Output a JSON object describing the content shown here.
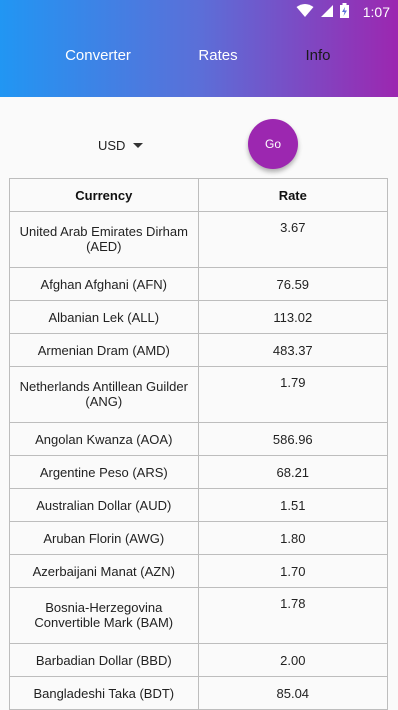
{
  "status_bar": {
    "time": "1:07",
    "icons": [
      "wifi-icon",
      "signal-icon",
      "battery-charging-icon"
    ]
  },
  "tabs": [
    {
      "label": "Converter"
    },
    {
      "label": "Rates"
    },
    {
      "label": "Info"
    }
  ],
  "controls": {
    "base_currency": "USD",
    "go_label": "Go"
  },
  "table": {
    "headers": [
      "Currency",
      "Rate"
    ],
    "rows": [
      {
        "currency": "United Arab Emirates Dirham (AED)",
        "rate": "3.67"
      },
      {
        "currency": "Afghan Afghani (AFN)",
        "rate": "76.59"
      },
      {
        "currency": "Albanian Lek (ALL)",
        "rate": "113.02"
      },
      {
        "currency": "Armenian Dram (AMD)",
        "rate": "483.37"
      },
      {
        "currency": "Netherlands Antillean Guilder (ANG)",
        "rate": "1.79"
      },
      {
        "currency": "Angolan Kwanza (AOA)",
        "rate": "586.96"
      },
      {
        "currency": "Argentine Peso (ARS)",
        "rate": "68.21"
      },
      {
        "currency": "Australian Dollar (AUD)",
        "rate": "1.51"
      },
      {
        "currency": "Aruban Florin (AWG)",
        "rate": "1.80"
      },
      {
        "currency": "Azerbaijani Manat (AZN)",
        "rate": "1.70"
      },
      {
        "currency": "Bosnia-Herzegovina Convertible Mark (BAM)",
        "rate": "1.78"
      },
      {
        "currency": "Barbadian Dollar (BBD)",
        "rate": "2.00"
      },
      {
        "currency": "Bangladeshi Taka (BDT)",
        "rate": "85.04"
      }
    ]
  },
  "colors": {
    "accent": "#9c27b0",
    "gradient_start": "#2196f3",
    "gradient_end": "#9c27b0"
  }
}
